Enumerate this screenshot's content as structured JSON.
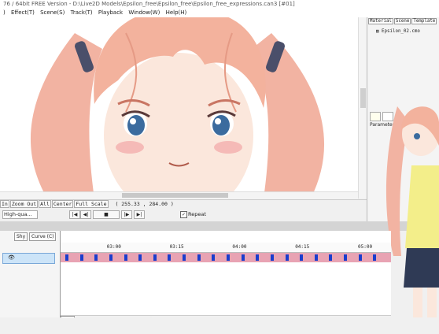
{
  "window": {
    "title": "76 / 64bit  FREE Version - D:\\Live2D Models\\Epsilon_free\\Epsilon_free\\Epsilon_free_expressions.can3  [#01]"
  },
  "menu": [
    ")",
    "Effect(T)",
    "Scene(S)",
    "Track(T)",
    "Playback",
    "Window(W)",
    "Help(H)"
  ],
  "zoom_toolbar": {
    "zoom_in": "In",
    "zoom_out": "Zoom Out",
    "all": "All",
    "center": "Center",
    "full_scale": "Full Scale",
    "coords": "( 255.33 ,  284.00 )"
  },
  "playback": {
    "quality": "High-qua...",
    "repeat_label": "Repeat",
    "repeat_checked": true
  },
  "side_panel": {
    "tabs": [
      "Material",
      "Scene",
      "Template"
    ],
    "model_file": "Epsilon_02.cmo",
    "params_label": "Parameters"
  },
  "timeline": {
    "tabs": [
      "Shy",
      "Curve (C)"
    ],
    "ruler_labels": [
      "03:00",
      "03:15",
      "04:00",
      "04:15",
      "05:00"
    ],
    "ruler_label_positions_pct": [
      14,
      33,
      52,
      71,
      90
    ],
    "keyframe_count": 22,
    "scroll_label": "<->"
  },
  "colors": {
    "accent_green": "#22aa22",
    "track_pink": "#e8a3b3",
    "keyframe_blue": "#1a3dcc",
    "selected_row": "#cce4f8"
  }
}
